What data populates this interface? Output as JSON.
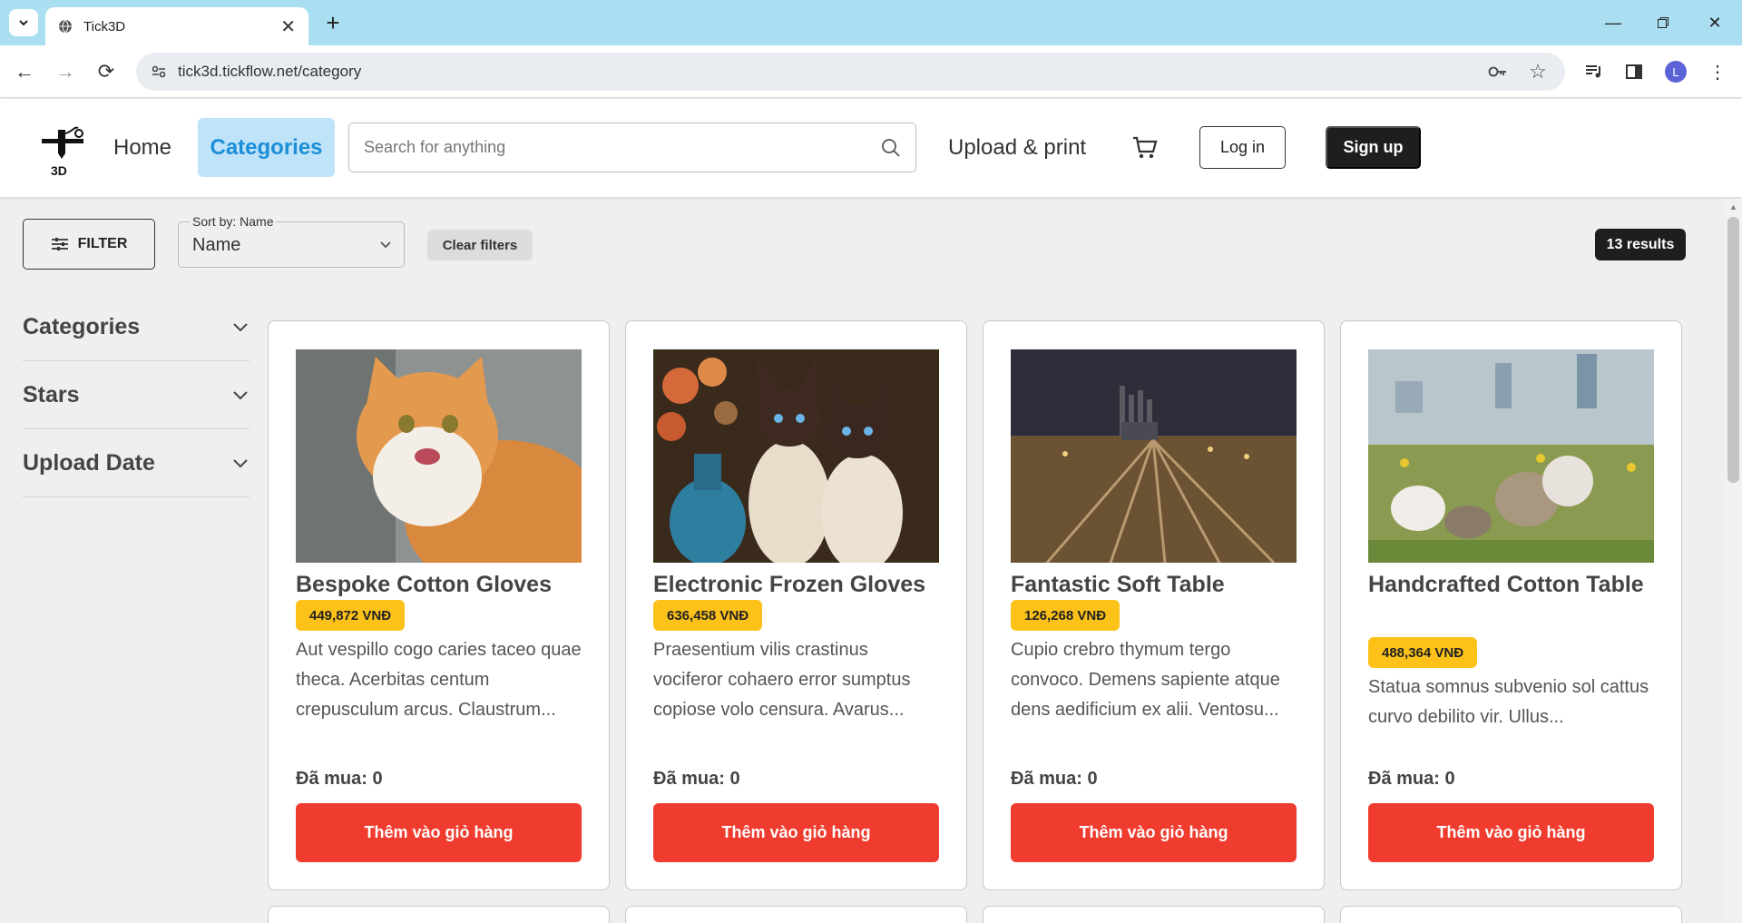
{
  "browser": {
    "tab_title": "Tick3D",
    "url": "tick3d.tickflow.net/category",
    "profile_initial": "L"
  },
  "header": {
    "logo_text": "3D",
    "nav_home": "Home",
    "nav_categories": "Categories",
    "search_placeholder": "Search for anything",
    "nav_upload": "Upload & print",
    "login_label": "Log in",
    "signup_label": "Sign up"
  },
  "toolbar": {
    "filter_label": "FILTER",
    "sort_legend": "Sort by: Name",
    "sort_value": "Name",
    "clear_label": "Clear filters",
    "results": "13 results"
  },
  "sidebar": {
    "items": [
      {
        "label": "Categories"
      },
      {
        "label": "Stars"
      },
      {
        "label": "Upload Date"
      }
    ]
  },
  "products": [
    {
      "title": "Bespoke Cotton Gloves",
      "price": "449,872 VNĐ",
      "desc": "Aut vespillo cogo caries taceo quae theca. Acerbitas centum crepusculum arcus. Claustrum...",
      "bought": "Đã mua: 0",
      "cart_label": "Thêm vào giỏ hàng"
    },
    {
      "title": "Electronic Frozen Gloves",
      "price": "636,458 VNĐ",
      "desc": "Praesentium vilis crastinus vociferor cohaero error sumptus copiose volo censura. Avarus...",
      "bought": "Đã mua: 0",
      "cart_label": "Thêm vào giỏ hàng"
    },
    {
      "title": "Fantastic Soft Table",
      "price": "126,268 VNĐ",
      "desc": "Cupio crebro thymum tergo convoco. Demens sapiente atque dens aedificium ex alii. Ventosu...",
      "bought": "Đã mua: 0",
      "cart_label": "Thêm vào giỏ hàng"
    },
    {
      "title": "Handcrafted Cotton Table",
      "price": "488,364 VNĐ",
      "desc": "Statua somnus subvenio sol cattus curvo debilito vir. Ullus...",
      "bought": "Đã mua: 0",
      "cart_label": "Thêm vào giỏ hàng"
    }
  ],
  "colors": {
    "accent_blue": "#1b8ed8",
    "price_badge": "#fcc219",
    "cart_button": "#f03c2e"
  }
}
